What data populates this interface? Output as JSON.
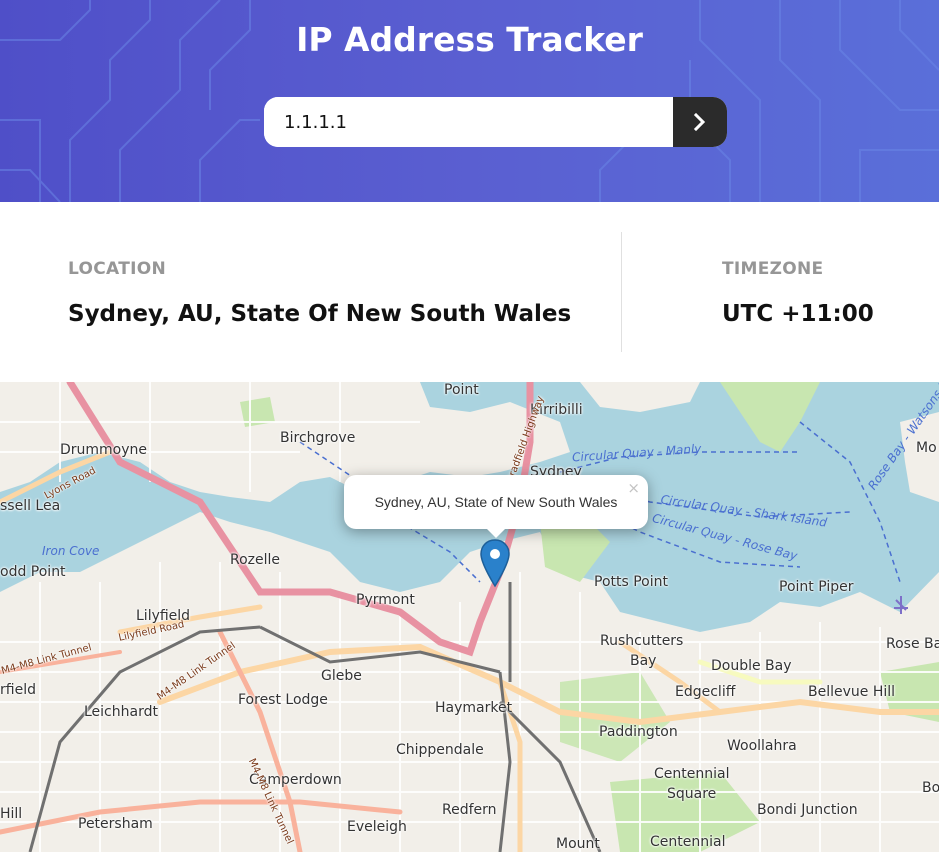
{
  "header": {
    "title": "IP Address Tracker",
    "search": {
      "value": "1.1.1.1",
      "placeholder": ""
    },
    "submit_icon": "chevron-right-icon",
    "colors": {
      "gradient_start": "#4f4fc8",
      "gradient_end": "#5a6fd9",
      "button": "#2b2b2b"
    }
  },
  "info": {
    "location": {
      "label": "LOCATION",
      "value": "Sydney, AU, State Of New South Wales"
    },
    "timezone": {
      "label": "TIMEZONE",
      "value": "UTC +11:00"
    }
  },
  "map": {
    "popup": {
      "text": "Sydney, AU, State of New South Wales",
      "close": "×"
    },
    "marker_icon": "map-pin-icon",
    "place_labels": [
      "Point",
      "Kirribilli",
      "Drummoyne",
      "Birchgrove",
      "Sydney",
      "ssell Lea",
      "Iron Cove",
      "Rozelle",
      "odd Point",
      "Pyrmont",
      "Potts Point",
      "Point Piper",
      "Lilyfield",
      "Rushcutters",
      "Bay",
      "Double Bay",
      "Rose Ba",
      "rfield",
      "Glebe",
      "Leichhardt",
      "Forest Lodge",
      "Haymarket",
      "Edgecliff",
      "Bellevue Hill",
      "Paddington",
      "Chippendale",
      "Woollahra",
      "Camperdown",
      "Centennial",
      "Square",
      "Bondi Junction",
      "Hill",
      "Petersham",
      "Redfern",
      "Eveleigh",
      "Mount",
      "Centennial",
      "Mo",
      "Bo"
    ],
    "water_labels": [
      "Circular Quay - Manly",
      "Circular Quay - Shark Island",
      "Circular Quay - Rose Bay",
      "Rose Bay - Watsons Bay"
    ],
    "road_labels": [
      "Lyons Road",
      "Lilyfield Road",
      "M4-M8 Link Tunnel",
      "M4-M8 Link Tunnel",
      "Bradfield Highway",
      "M4-M8 Link Tunnel"
    ]
  }
}
